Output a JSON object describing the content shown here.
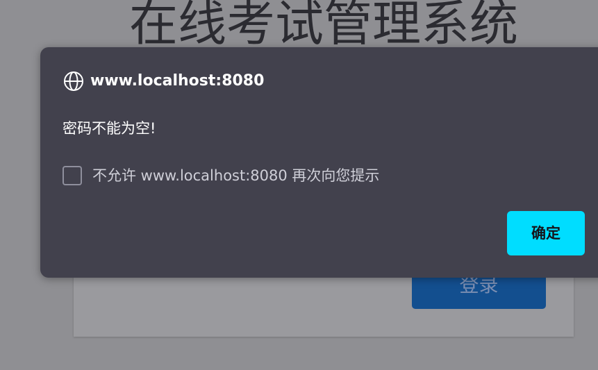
{
  "page": {
    "title": "在线考试管理系统",
    "login_button_label": "登录"
  },
  "dialog": {
    "origin": "www.localhost:8080",
    "message": "密码不能为空!",
    "checkbox_label": "不允许 www.localhost:8080 再次向您提示",
    "checkbox_checked": false,
    "ok_label": "确定",
    "icon": "globe-icon"
  },
  "colors": {
    "page_background": "#8f8f93",
    "dialog_background": "#42414d",
    "accent": "#00ddff",
    "login_button": "#134f8f"
  }
}
